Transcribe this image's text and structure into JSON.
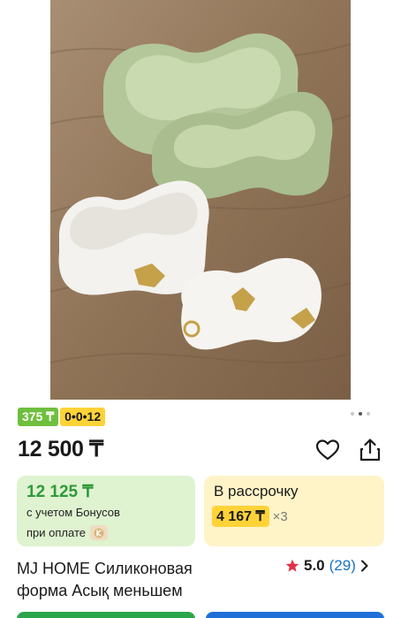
{
  "product": {
    "badges": {
      "bonus": "375 ₸",
      "installment_plan": "0•0•12"
    },
    "price": "12 500 ₸",
    "bonus_card": {
      "price": "12 125 ₸",
      "line1": "с учетом Бонусов",
      "line2": "при оплате"
    },
    "installment_card": {
      "title": "В рассрочку",
      "amount": "4 167 ₸",
      "multiplier": "×3"
    },
    "title_line1": "MJ HOME Силиконовая",
    "title_line2": "форма Асық меньшем",
    "rating": {
      "value": "5.0",
      "count": "(29)"
    }
  },
  "gallery": {
    "dots": 3,
    "active_index": 1
  },
  "colors": {
    "bonus_green": "#6fbf3f",
    "accent_yellow": "#ffd338",
    "bonus_card_bg": "#dff3d0",
    "installment_card_bg": "#fff4c8",
    "star": "#e0334a",
    "link_blue": "#1a73c8"
  },
  "icons": [
    "heart-icon",
    "share-icon",
    "star-icon",
    "chevron-right-icon",
    "kaspi-icon"
  ]
}
